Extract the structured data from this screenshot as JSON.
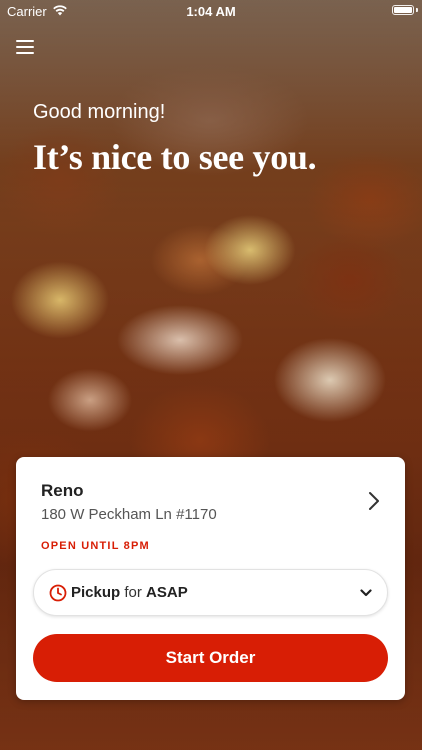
{
  "status_bar": {
    "carrier": "Carrier",
    "time": "1:04 AM"
  },
  "header": {
    "menu_icon": "hamburger-menu-icon"
  },
  "hero": {
    "greeting": "Good morning!",
    "headline": "It’s nice to see you."
  },
  "location_card": {
    "store_name": "Reno",
    "address": "180 W Peckham Ln #1170",
    "hours": "OPEN UNTIL 8PM",
    "navigate_icon": "chevron-right-icon",
    "order_mode": {
      "mode": "Pickup",
      "connector": " for ",
      "time": "ASAP",
      "icon": "clock-icon",
      "dropdown_icon": "chevron-down-icon"
    },
    "start_order_label": "Start Order"
  },
  "colors": {
    "accent": "#d81e05",
    "card_background": "#ffffff",
    "text_primary": "#222222",
    "text_secondary": "#555555"
  }
}
